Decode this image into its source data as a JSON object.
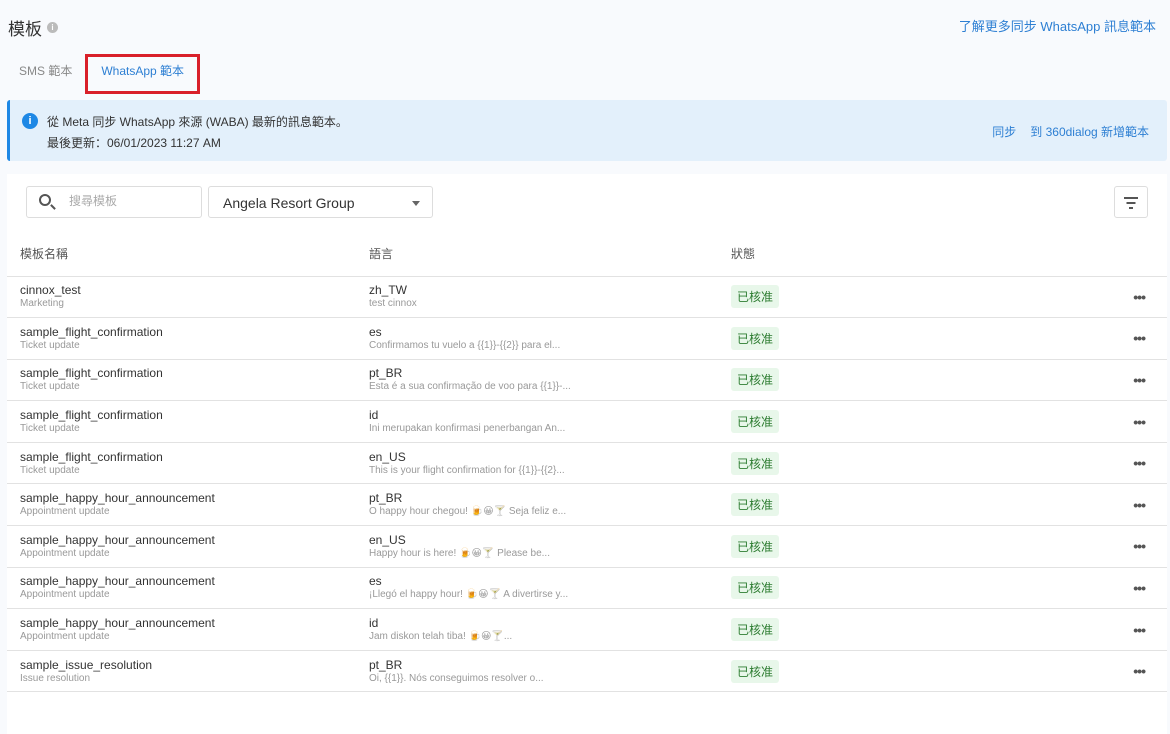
{
  "header": {
    "title": "模板",
    "learn_more": "了解更多同步 WhatsApp 訊息範本"
  },
  "tabs": [
    {
      "label": "SMS 範本"
    },
    {
      "label": "WhatsApp 範本"
    }
  ],
  "banner": {
    "message": "從 Meta 同步 WhatsApp 來源 (WABA) 最新的訊息範本。",
    "last_updated": "最後更新：06/01/2023 11:27 AM",
    "sync": "同步",
    "add_template": "到 360dialog 新增範本"
  },
  "toolbar": {
    "search_placeholder": "搜尋模板",
    "account": "Angela Resort Group"
  },
  "table": {
    "headers": [
      "模板名稱",
      "語言",
      "狀態"
    ],
    "rows": [
      {
        "name": "cinnox_test",
        "category": "Marketing",
        "lang": "zh_TW",
        "preview": "test cinnox",
        "status": "已核准"
      },
      {
        "name": "sample_flight_confirmation",
        "category": "Ticket update",
        "lang": "es",
        "preview": "Confirmamos tu vuelo a {{1}}-{{2}} para el...",
        "status": "已核准"
      },
      {
        "name": "sample_flight_confirmation",
        "category": "Ticket update",
        "lang": "pt_BR",
        "preview": "Esta é a sua confirmação de voo para {{1}}-...",
        "status": "已核准"
      },
      {
        "name": "sample_flight_confirmation",
        "category": "Ticket update",
        "lang": "id",
        "preview": "Ini merupakan konfirmasi penerbangan An...",
        "status": "已核准"
      },
      {
        "name": "sample_flight_confirmation",
        "category": "Ticket update",
        "lang": "en_US",
        "preview": "This is your flight confirmation for {{1}}-{{2}...",
        "status": "已核准"
      },
      {
        "name": "sample_happy_hour_announcement",
        "category": "Appointment update",
        "lang": "pt_BR",
        "preview": "O happy hour chegou! 🍺😀🍸 Seja feliz e...",
        "status": "已核准"
      },
      {
        "name": "sample_happy_hour_announcement",
        "category": "Appointment update",
        "lang": "en_US",
        "preview": "Happy hour is here! 🍺😀🍸 Please be...",
        "status": "已核准"
      },
      {
        "name": "sample_happy_hour_announcement",
        "category": "Appointment update",
        "lang": "es",
        "preview": "¡Llegó el happy hour! 🍺😀🍸 A divertirse y...",
        "status": "已核准"
      },
      {
        "name": "sample_happy_hour_announcement",
        "category": "Appointment update",
        "lang": "id",
        "preview": "Jam diskon telah tiba! 🍺😀🍸...",
        "status": "已核准"
      },
      {
        "name": "sample_issue_resolution",
        "category": "Issue resolution",
        "lang": "pt_BR",
        "preview": "Oi, {{1}}. Nós conseguimos resolver o...",
        "status": "已核准"
      }
    ]
  }
}
